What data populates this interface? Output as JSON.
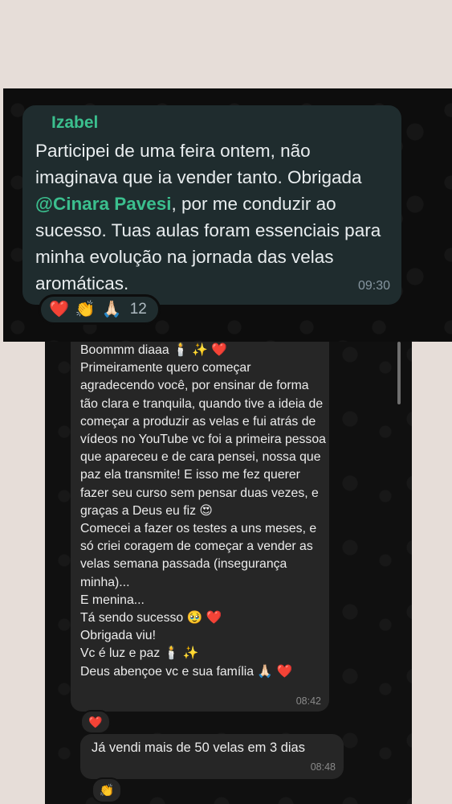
{
  "screenshot1": {
    "sender": "Izabel",
    "message_before_mention": "Participei de uma feira ontem, não imaginava que ia vender tanto. Obrigada ",
    "mention": "@Cinara Pavesi",
    "message_after_mention": ", por me conduzir ao sucesso. Tuas aulas foram essenciais para minha evolução na jornada das velas aromáticas.",
    "time": "09:30",
    "reactions": {
      "emoji_1": "❤️",
      "emoji_2": "👏",
      "emoji_3": "🙏🏻",
      "count": "12"
    }
  },
  "screenshot2": {
    "long_message_lines": [
      "Boommm diaaa 🕯️ ✨ ❤️",
      "Primeiramente quero começar agradecendo você, por ensinar de forma tão clara e tranquila, quando tive a ideia de começar a produzir as velas e fui atrás de vídeos no YouTube vc foi a primeira pessoa que apareceu e de cara pensei, nossa que paz ela transmite! E isso me fez querer fazer seu curso sem pensar duas vezes, e graças a Deus eu fiz 😍",
      "Comecei a fazer os testes a uns meses, e só criei coragem de começar a vender as velas semana passada (insegurança minha)...",
      "E menina...",
      "Tá sendo sucesso 🥹 ❤️",
      "Obrigada viu!",
      "Vc é luz e paz 🕯️ ✨",
      "Deus abençoe vc e sua família 🙏🏻 ❤️"
    ],
    "long_message_time": "08:42",
    "long_message_reaction": "❤️",
    "short_message": "Já vendi mais de 50 velas em 3 dias",
    "short_message_time": "08:48",
    "short_message_reaction": "👏"
  }
}
